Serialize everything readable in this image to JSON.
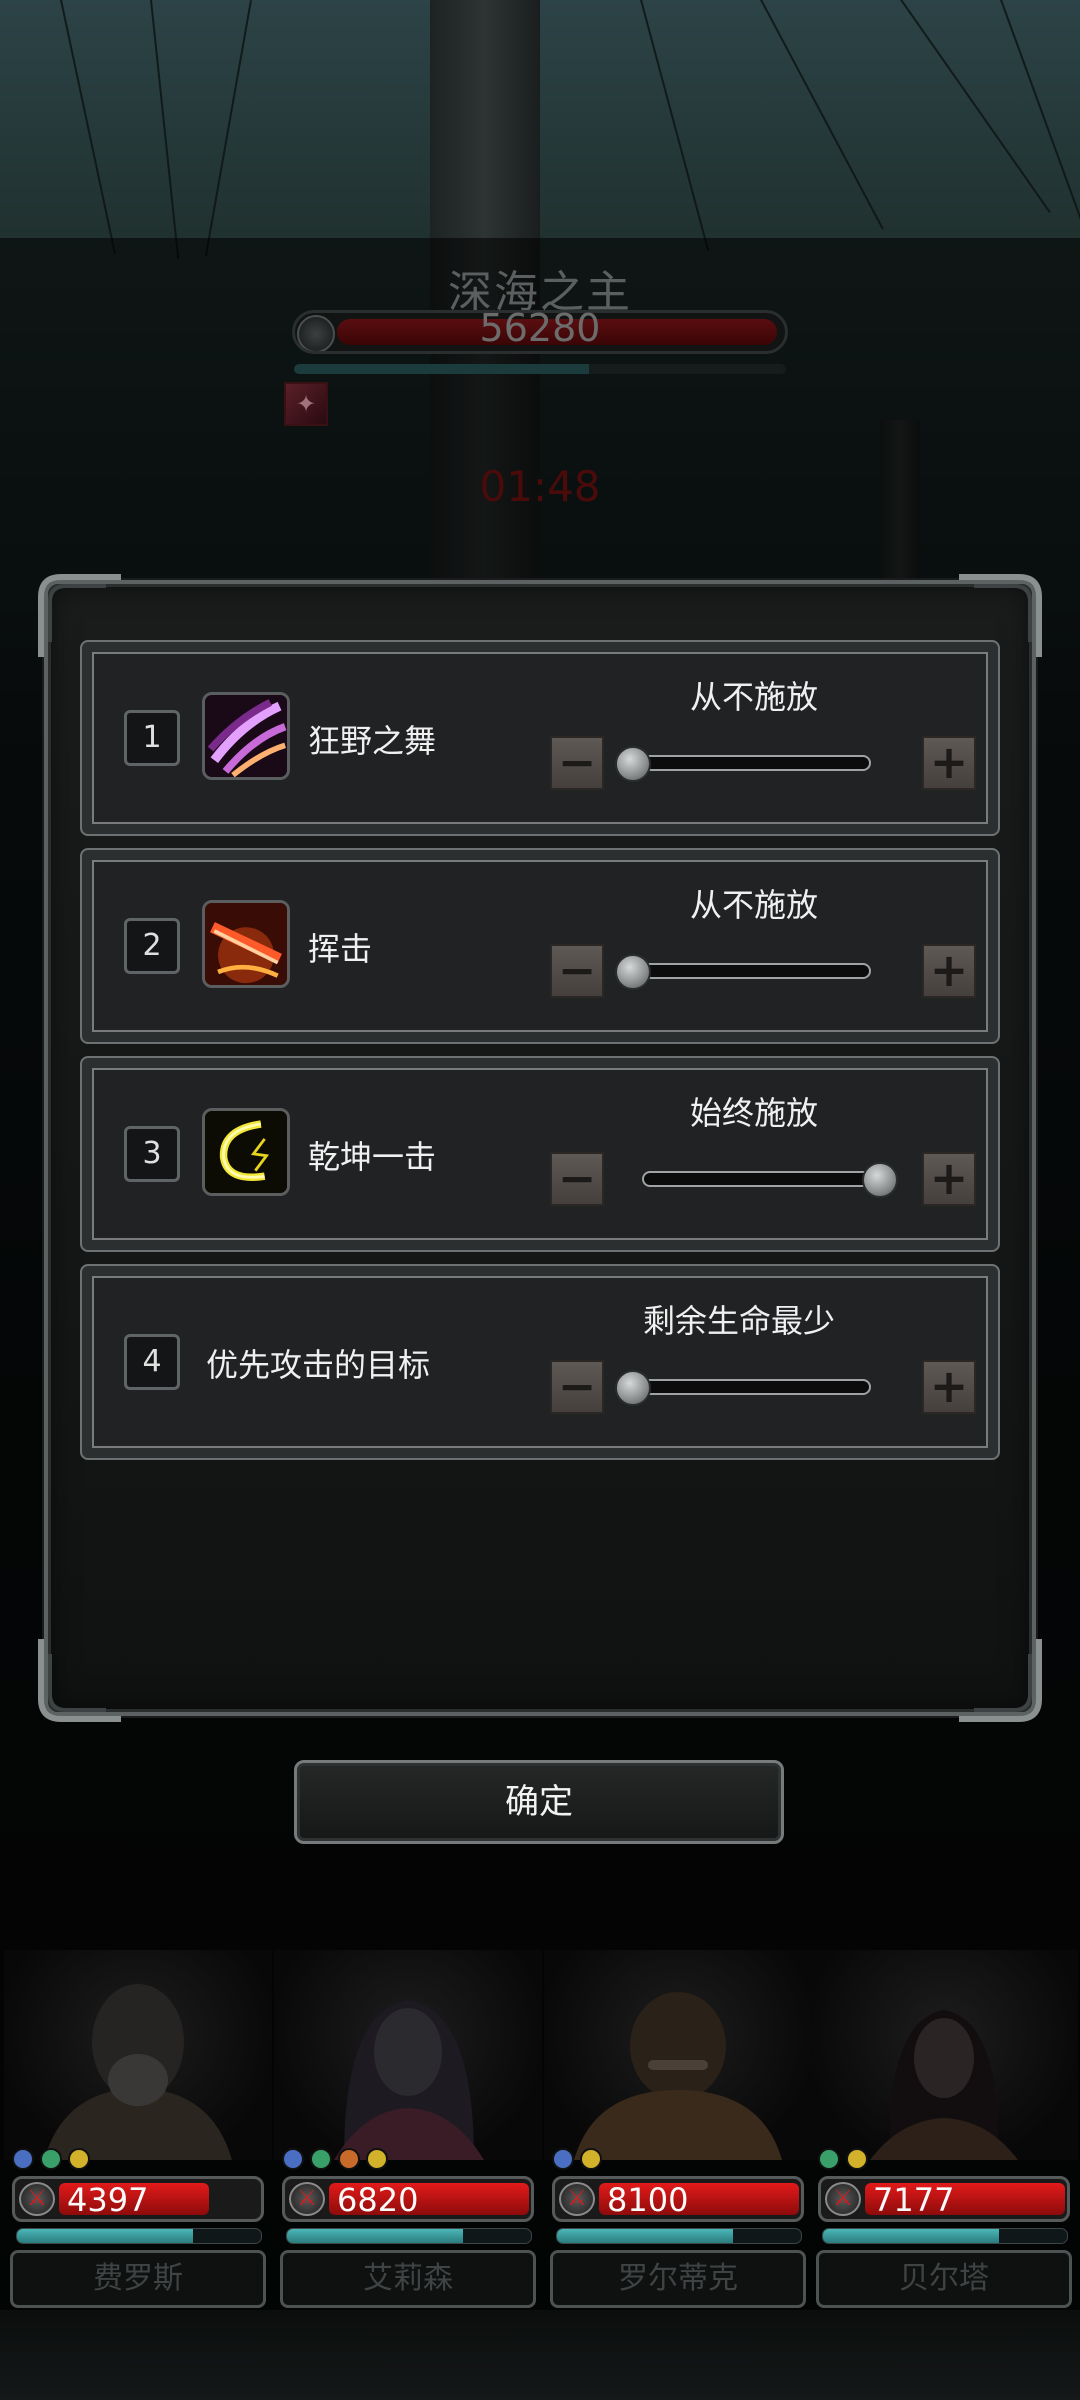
{
  "boss": {
    "name": "深海之主",
    "hp": "56280",
    "timer": "01:48"
  },
  "settings": {
    "rows": [
      {
        "number": "1",
        "name": "狂野之舞",
        "icon": "wild-dance-skill-icon",
        "mode": "从不施放",
        "slider_level": 0
      },
      {
        "number": "2",
        "name": "挥击",
        "icon": "swing-strike-skill-icon",
        "mode": "从不施放",
        "slider_level": 0
      },
      {
        "number": "3",
        "name": "乾坤一击",
        "icon": "lightning-strike-skill-icon",
        "mode": "始终施放",
        "slider_level": 1
      },
      {
        "number": "4",
        "name": "优先攻击的目标",
        "icon": null,
        "mode": "剩余生命最少",
        "slider_level": 0
      }
    ],
    "minus_label": "−",
    "plus_label": "+"
  },
  "confirm_label": "确定",
  "heroes": [
    {
      "name": "费罗斯",
      "hp": "4397",
      "hp_fraction": 0.75,
      "mana_fraction": 0.72,
      "gems": [
        "#4a6fc2",
        "#3aa06a",
        "#d2b22a"
      ]
    },
    {
      "name": "艾莉森",
      "hp": "6820",
      "hp_fraction": 1.0,
      "mana_fraction": 0.72,
      "gems": [
        "#4a6fc2",
        "#3aa06a",
        "#c86a2a",
        "#d2b22a"
      ]
    },
    {
      "name": "罗尔蒂克",
      "hp": "8100",
      "hp_fraction": 1.0,
      "mana_fraction": 0.72,
      "gems": [
        "#4a6fc2",
        "#d2b22a"
      ]
    },
    {
      "name": "贝尔塔",
      "hp": "7177",
      "hp_fraction": 1.0,
      "mana_fraction": 0.72,
      "gems": [
        "#3aa06a",
        "#d2b22a"
      ]
    }
  ],
  "colors": {
    "hp_red": "#e21a1a",
    "mana_teal": "#4bb7b8",
    "panel_border": "#5c6161"
  }
}
